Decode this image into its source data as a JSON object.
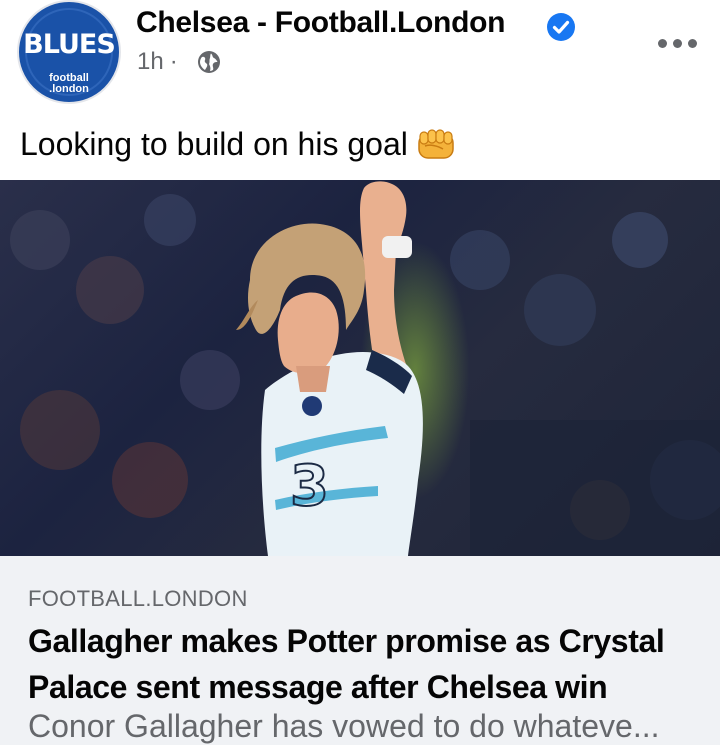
{
  "post": {
    "page_name": "Chelsea - Football.London",
    "time": "1h",
    "separator": "·",
    "caption": "Looking to build on his goal",
    "avatar": {
      "main_text": "BLUES",
      "sub_line1": "football",
      "sub_line2": ".london"
    },
    "icons": {
      "verified": "verified-badge-icon",
      "privacy": "globe-icon",
      "more": "more-options-icon",
      "emoji": "oncoming-fist-emoji"
    }
  },
  "link_preview": {
    "domain": "FOOTBALL.LONDON",
    "title": "Gallagher makes Potter promise as Crystal Palace sent message after Chelsea win",
    "description": "Conor Gallagher has vowed to do whateve..."
  },
  "colors": {
    "brand_blue": "#1a52a8",
    "verified_blue": "#1877f2",
    "secondary_text": "#65676b",
    "link_bg": "#f0f2f5"
  }
}
